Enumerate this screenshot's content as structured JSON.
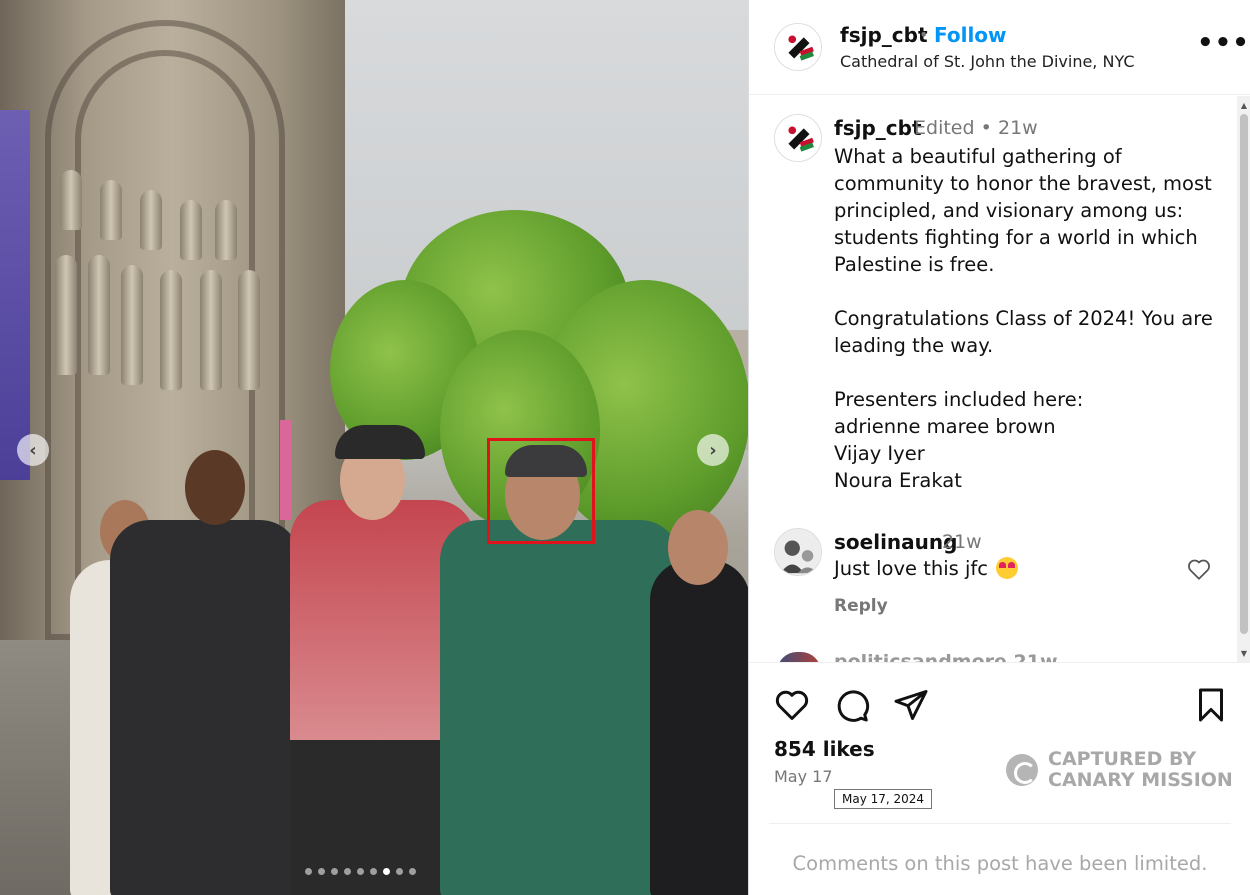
{
  "photo": {
    "carousel_dots": 9,
    "active_dot": 6,
    "prev_label": "‹",
    "next_label": "›"
  },
  "header": {
    "username": "fsjp_cbt",
    "separator": "•",
    "follow_label": "Follow",
    "location": "Cathedral of St. John the Divine, NYC",
    "more_label": "•••"
  },
  "caption": {
    "username": "fsjp_cbt",
    "edited": "Edited •",
    "time": "21w",
    "lines": [
      "What a beautiful gathering of",
      "community to honor the bravest, most",
      "principled, and visionary among us:",
      "students fighting for a world in which",
      "Palestine is free.",
      "",
      "Congratulations Class of 2024! You are",
      "leading the way.",
      "",
      "Presenters included here:",
      "adrienne maree brown",
      "Vijay Iyer",
      "Noura Erakat"
    ]
  },
  "comment": {
    "username": "soelinaung",
    "time": "21w",
    "text": "Just love this jfc",
    "emoji": "heart-eyes-emoji",
    "reply_label": "Reply",
    "next_partial": "politicsandmore   21w"
  },
  "actions": {
    "likes": "854 likes",
    "date": "May 17",
    "date_tooltip": "May 17, 2024",
    "comments_limited": "Comments on this post have been limited."
  },
  "watermark": {
    "line1": "CAPTURED BY",
    "line2": "CANARY MISSION"
  },
  "colors": {
    "follow": "#0095f6",
    "face_box": "#e0121b",
    "muted_text": "#777777"
  }
}
